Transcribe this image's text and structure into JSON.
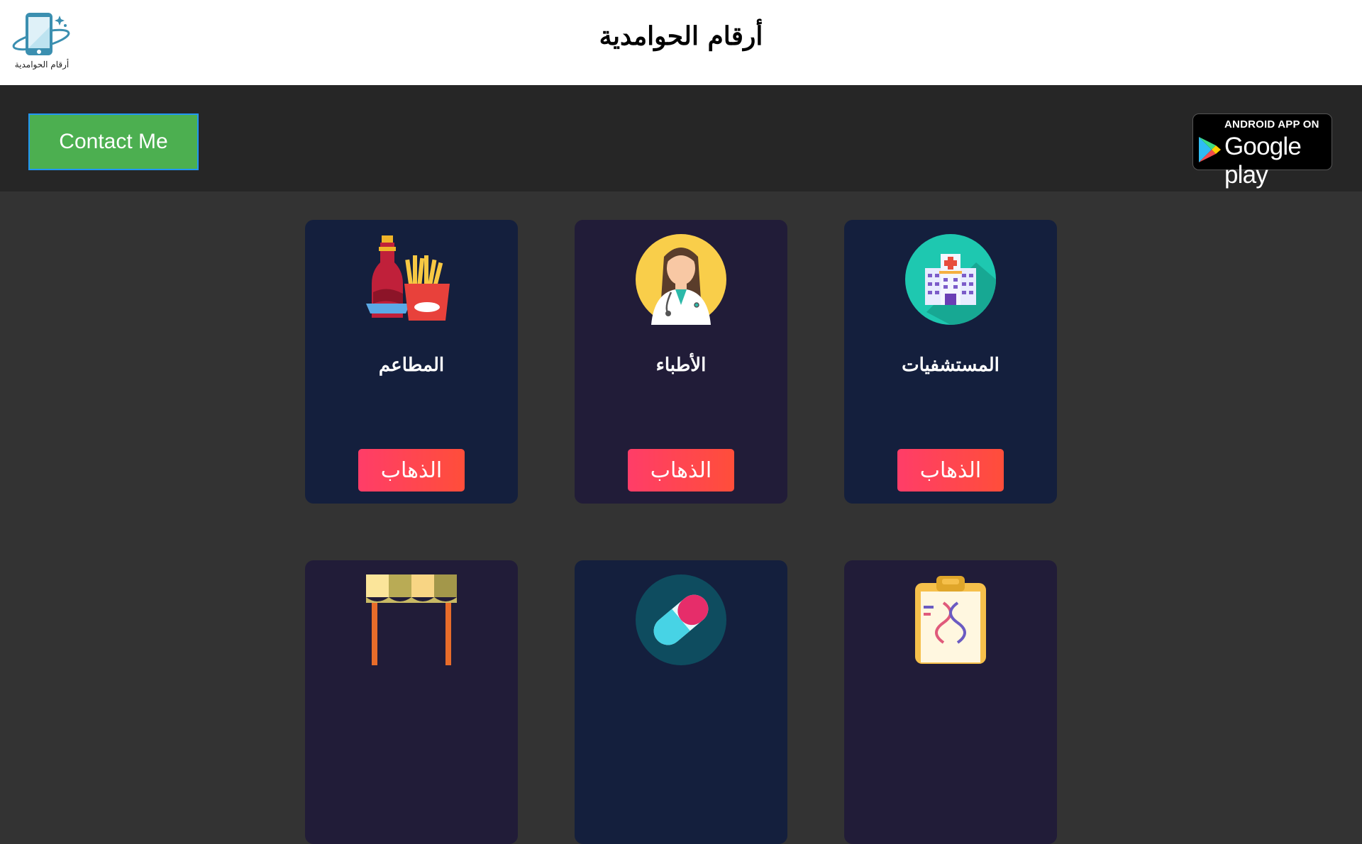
{
  "header": {
    "site_title": "أرقام الحوامدية",
    "logo_text": "أرقام الحوامدية"
  },
  "navbar": {
    "contact_label": "Contact Me",
    "google_play": {
      "top_text": "ANDROID APP ON",
      "bottom_text": "Google play"
    }
  },
  "cards": [
    {
      "title": "المستشفيات",
      "button": "الذهاب",
      "icon": "hospital-icon"
    },
    {
      "title": "الأطباء",
      "button": "الذهاب",
      "icon": "doctor-icon"
    },
    {
      "title": "المطاعم",
      "button": "الذهاب",
      "icon": "food-icon"
    },
    {
      "title": "",
      "button": "",
      "icon": "lab-report-icon"
    },
    {
      "title": "",
      "button": "",
      "icon": "pill-icon"
    },
    {
      "title": "",
      "button": "",
      "icon": "market-stall-icon"
    }
  ],
  "colors": {
    "header_bg": "#ffffff",
    "navbar_bg": "#262626",
    "page_bg": "#333333",
    "card_navy": "#141f3d",
    "card_purple": "#211c38",
    "contact_green": "#4caf50",
    "button_red": "#ff3d68"
  }
}
